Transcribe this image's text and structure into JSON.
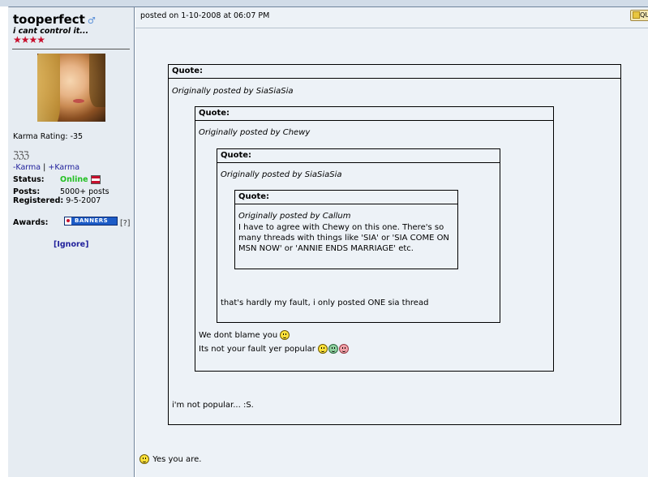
{
  "user": {
    "name": "tooperfect",
    "gender_symbol": "♂",
    "title": "i cant control it...",
    "stars": "★★★★",
    "karma_rating": "Karma Rating: -35",
    "karma_symbols": "ℨℨℨ",
    "karma_minus": "-Karma",
    "karma_sep": "|",
    "karma_plus": "+Karma",
    "status_label": "Status:",
    "status_value": "Online",
    "posts_label": "Posts:",
    "posts_value": "5000+ posts",
    "registered_label": "Registered:",
    "registered_value": "9-5-2007",
    "awards_label": "Awards:",
    "award_banner": "BANNERS",
    "award_help": "[?]",
    "ignore": "[Ignore]"
  },
  "post": {
    "posted_on": "posted on 1-10-2008 at 06:07 PM",
    "quote_button": "QU",
    "quotes": {
      "q1": {
        "label": "Quote:",
        "by": "Originally posted by SiaSiaSia",
        "reply": "i'm not popular... :S."
      },
      "q2": {
        "label": "Quote:",
        "by": "Originally posted by Chewy",
        "reply_line1": "We dont blame you",
        "reply_line2": "Its not your fault yer popular"
      },
      "q3": {
        "label": "Quote:",
        "by": "Originally posted by SiaSiaSia",
        "reply": "that's hardly my fault, i only posted ONE sia thread"
      },
      "q4": {
        "label": "Quote:",
        "by": "Originally posted by Callum",
        "text": "I have to agree with Chewy on this one. There's so many threads with things like 'SIA' or 'SIA COME ON MSN NOW' or 'ANNIE ENDS MARRIAGE' etc."
      }
    },
    "final_reply": "Yes you are."
  }
}
